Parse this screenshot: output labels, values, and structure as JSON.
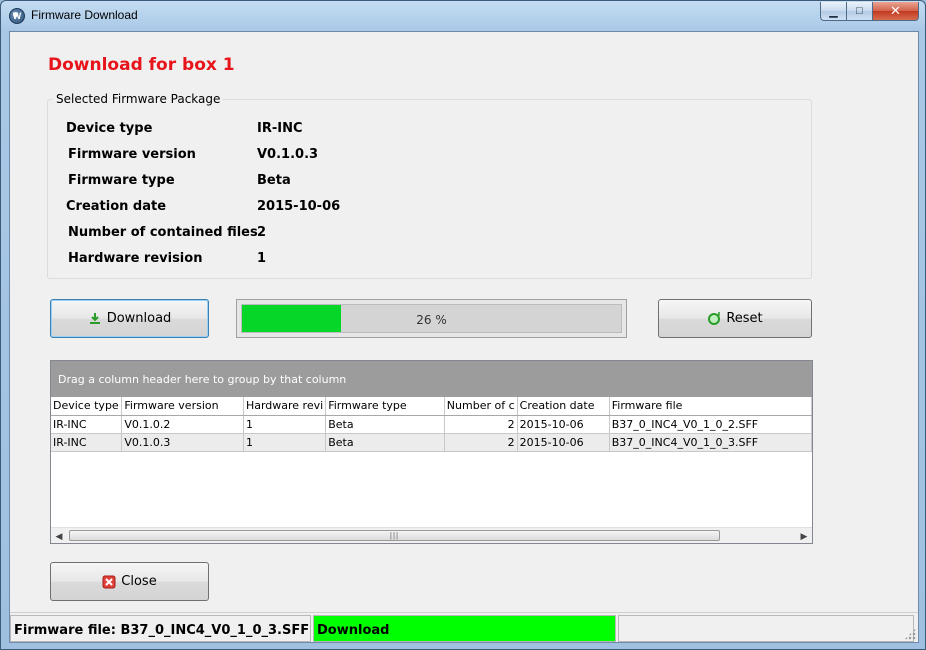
{
  "window": {
    "title": "Firmware Download"
  },
  "heading": "Download for box 1",
  "package": {
    "legend": "Selected Firmware Package",
    "rows": [
      {
        "label": "Device type",
        "value": "IR-INC"
      },
      {
        "label": "Firmware version",
        "value": "V0.1.0.3"
      },
      {
        "label": "Firmware type",
        "value": "Beta"
      },
      {
        "label": "Creation date",
        "value": "2015-10-06"
      },
      {
        "label": "Number of contained files",
        "value": "2"
      },
      {
        "label": "Hardware revision",
        "value": "1"
      }
    ]
  },
  "download_button": "Download",
  "reset_button": "Reset",
  "close_button": "Close",
  "progress": {
    "fraction": 0.26,
    "text": "26 %"
  },
  "grid": {
    "group_hint": "Drag a column header here to group by that column",
    "columns": [
      "Device type",
      "Firmware version",
      "Hardware revi",
      "Firmware type",
      "Number of c",
      "Creation date",
      "Firmware file"
    ],
    "rows": [
      [
        "IR-INC",
        "V0.1.0.2",
        "1",
        "Beta",
        "2",
        "2015-10-06",
        "B37_0_INC4_V0_1_0_2.SFF"
      ],
      [
        "IR-INC",
        "V0.1.0.3",
        "1",
        "Beta",
        "2",
        "2015-10-06",
        "B37_0_INC4_V0_1_0_3.SFF"
      ]
    ]
  },
  "status": {
    "file": "Firmware file: B37_0_INC4_V0_1_0_3.SFF",
    "state": "Download",
    "state_color": "#00ff00"
  },
  "colors": {
    "heading": "#e8141c",
    "progress_fill": "#06d628"
  }
}
